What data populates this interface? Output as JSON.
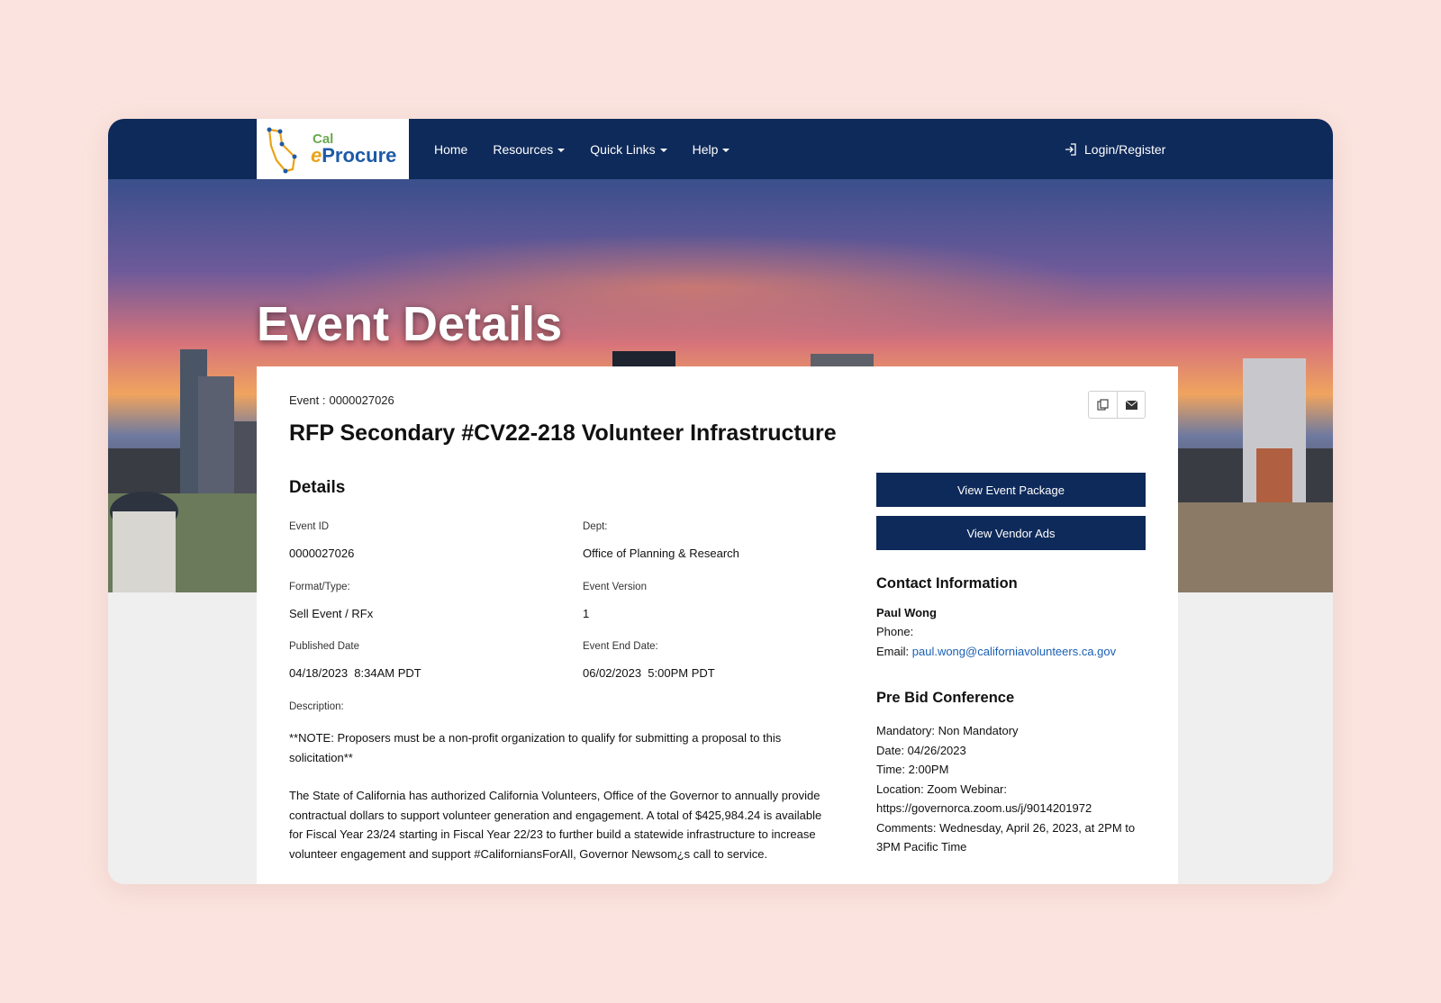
{
  "brand": {
    "logo_cal": "Cal",
    "logo_e": "e",
    "logo_procure": "Procure"
  },
  "nav": {
    "items": [
      {
        "label": "Home",
        "has_dropdown": false
      },
      {
        "label": "Resources",
        "has_dropdown": true
      },
      {
        "label": "Quick Links",
        "has_dropdown": true
      },
      {
        "label": "Help",
        "has_dropdown": true
      }
    ],
    "login_label": "Login/Register"
  },
  "hero": {
    "title": "Event Details"
  },
  "event": {
    "label": "Event :",
    "number": "0000027026",
    "title": "RFP Secondary #CV22-218 Volunteer Infrastructure"
  },
  "details": {
    "heading": "Details",
    "event_id_label": "Event ID",
    "event_id": "0000027026",
    "dept_label": "Dept:",
    "dept": "Office of Planning & Research",
    "format_label": "Format/Type:",
    "format": "Sell Event / RFx",
    "version_label": "Event Version",
    "version": "1",
    "published_label": "Published Date",
    "published": "04/18/2023  8:34AM PDT",
    "end_label": "Event End Date:",
    "end": "06/02/2023  5:00PM PDT",
    "description_label": "Description:",
    "description_note_1": "**NOTE: Proposers must be a non-profit organization to qualify for submitting a proposal to this",
    "description_note_2": "solicitation**",
    "description_body": [
      "The State of California has authorized California Volunteers, Office of the Governor to annually provide",
      "contractual dollars to support volunteer generation and engagement. A total of $425,984.24 is available",
      "for Fiscal Year 23/24 starting in Fiscal Year 22/23 to further build a statewide infrastructure to increase",
      "volunteer engagement and support #CaliforniansForAll, Governor Newsom¿s call to service."
    ]
  },
  "actions": {
    "view_package": "View Event Package",
    "view_vendor_ads": "View Vendor Ads"
  },
  "contact": {
    "heading": "Contact Information",
    "name": "Paul Wong",
    "phone_label": "Phone:",
    "email_label": "Email:",
    "email": "paul.wong@californiavolunteers.ca.gov"
  },
  "prebid": {
    "heading": "Pre Bid Conference",
    "lines": [
      "Mandatory: Non Mandatory",
      "Date: 04/26/2023",
      "Time: 2:00PM",
      "Location: Zoom Webinar:",
      "https://governorca.zoom.us/j/9014201972",
      "Comments: Wednesday, April 26, 2023, at 2PM to",
      "3PM Pacific Time"
    ]
  },
  "colors": {
    "nav": "#0e2a5a",
    "page_bg": "#fbe4df",
    "link": "#1a5fb4"
  }
}
